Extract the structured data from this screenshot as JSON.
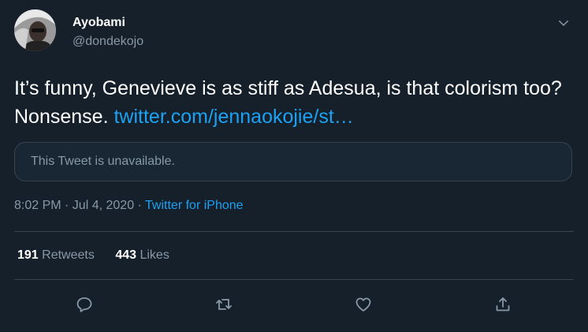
{
  "user": {
    "display_name": "Ayobami",
    "handle": "@dondekojo"
  },
  "tweet": {
    "text": "It’s funny, Genevieve is as stiff as Adesua, is that colorism too? Nonsense.",
    "link": "twitter.com/jennaokojie/st…",
    "quoted_unavailable": "This Tweet is unavailable.",
    "time": "8:02 PM · Jul 4, 2020",
    "separator": " · ",
    "source": "Twitter for iPhone"
  },
  "stats": {
    "retweets_count": "191",
    "retweets_label": "Retweets",
    "likes_count": "443",
    "likes_label": "Likes"
  },
  "icons": {
    "caret": "chevron-down-icon",
    "reply": "reply-icon",
    "retweet": "retweet-icon",
    "like": "heart-icon",
    "share": "share-icon"
  },
  "colors": {
    "background": "#15202b",
    "text": "#ffffff",
    "secondary": "#8899a6",
    "accent": "#1da1f2",
    "border": "#38444d"
  }
}
